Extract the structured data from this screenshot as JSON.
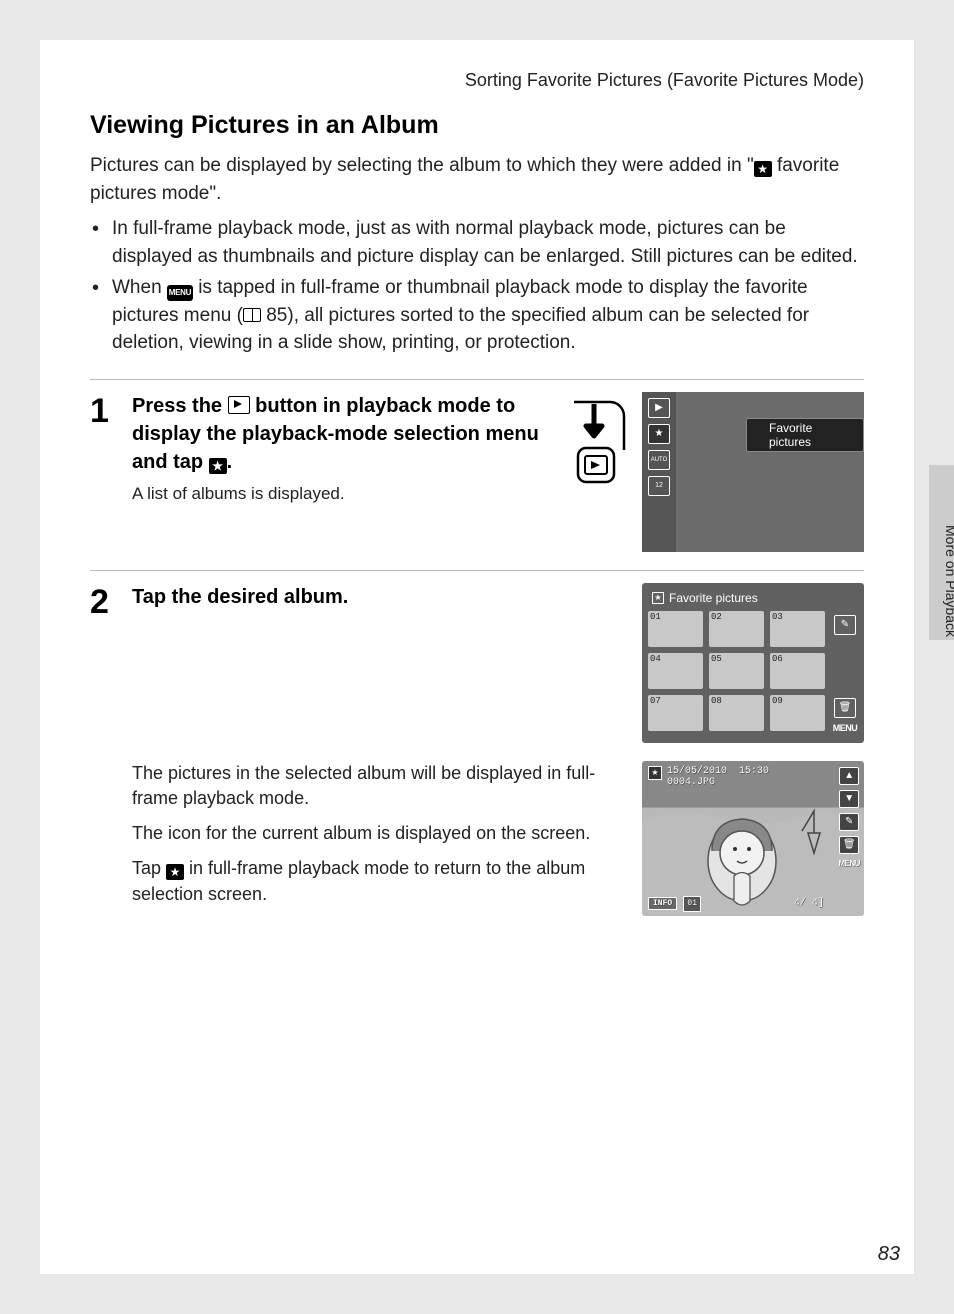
{
  "breadcrumb": "Sorting Favorite Pictures (Favorite Pictures Mode)",
  "side_tab": "More on Playback",
  "page_number": "83",
  "title": "Viewing Pictures in an Album",
  "intro_pre": "Pictures can be displayed by selecting the album to which they were added in \"",
  "intro_post": " favorite pictures mode\".",
  "bullet1": "In full-frame playback mode, just as with normal playback mode, pictures can be displayed as thumbnails and picture display can be enlarged. Still pictures can be edited.",
  "bullet2_pre": "When ",
  "bullet2_mid": " is tapped in full-frame or thumbnail playback mode to display the favorite pictures menu (",
  "bullet2_ref": " 85), all pictures sorted to the specified album can be selected for deletion, viewing in a slide show, printing, or protection.",
  "menu_label": "MENU",
  "step1": {
    "num": "1",
    "title_a": "Press the ",
    "title_b": " button in playback mode to display the playback-mode selection menu and tap ",
    "title_c": ".",
    "sub": "A list of albums is displayed.",
    "mode_label": "Favorite pictures",
    "mode_icons": [
      "▶",
      "★",
      "AUTO",
      "12"
    ]
  },
  "step2": {
    "num": "2",
    "title": "Tap the desired album.",
    "grid_header": "Favorite pictures",
    "albums": [
      "01",
      "02",
      "03",
      "04",
      "05",
      "06",
      "07",
      "08",
      "09"
    ],
    "para1": "The pictures in the selected album will be displayed in full-frame playback mode.",
    "para2": "The icon for the current album is displayed on the screen.",
    "para3_a": "Tap ",
    "para3_b": " in full-frame playback mode to return to the album selection screen.",
    "playback": {
      "date": "15/05/2010",
      "time": "15:30",
      "file": "0004.JPG",
      "info": "INFO",
      "album": "01",
      "counter": "4/    4]",
      "menu": "MENU"
    }
  }
}
